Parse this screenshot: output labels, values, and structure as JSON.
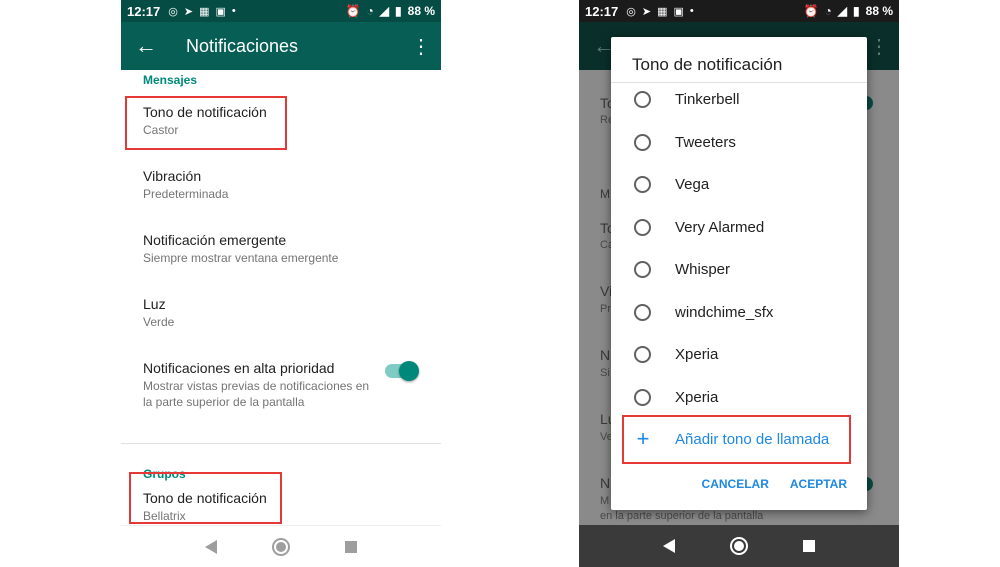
{
  "left": {
    "status": {
      "time": "12:17",
      "battery": "88 %"
    },
    "appbar": {
      "title": "Notificaciones"
    },
    "sections": [
      {
        "header": "Mensajes",
        "items": [
          {
            "title": "Tono de notificación",
            "subtitle": "Castor"
          },
          {
            "title": "Vibración",
            "subtitle": "Predeterminada"
          },
          {
            "title": "Notificación emergente",
            "subtitle": "Siempre mostrar ventana emergente"
          },
          {
            "title": "Luz",
            "subtitle": "Verde"
          },
          {
            "title": "Notificaciones en alta prioridad",
            "subtitle": "Mostrar vistas previas de notificaciones en la parte superior de la pantalla",
            "toggle": true
          }
        ]
      },
      {
        "header": "Grupos",
        "items": [
          {
            "title": "Tono de notificación",
            "subtitle": "Bellatrix"
          }
        ]
      }
    ]
  },
  "right": {
    "status": {
      "time": "12:17",
      "battery": "88 %"
    },
    "background": {
      "letters": [
        "To",
        "Re",
        "M",
        "To",
        "Ca",
        "Vi",
        "Pr",
        "N",
        "Si",
        "Lu",
        "Ve",
        "N",
        "M"
      ],
      "bottom_text": "en la parte superior de la pantalla"
    },
    "dialog": {
      "title": "Tono de notificación",
      "options": [
        "Tinkerbell",
        "Tweeters",
        "Vega",
        "Very Alarmed",
        "Whisper",
        "windchime_sfx",
        "Xperia",
        "Xperia"
      ],
      "add_label": "Añadir tono de llamada",
      "cancel_label": "CANCELAR",
      "accept_label": "ACEPTAR"
    }
  },
  "colors": {
    "appbar": "#075e54",
    "accent": "#00897b",
    "highlight": "#e53935",
    "dialog_accent": "#1e88e5"
  }
}
